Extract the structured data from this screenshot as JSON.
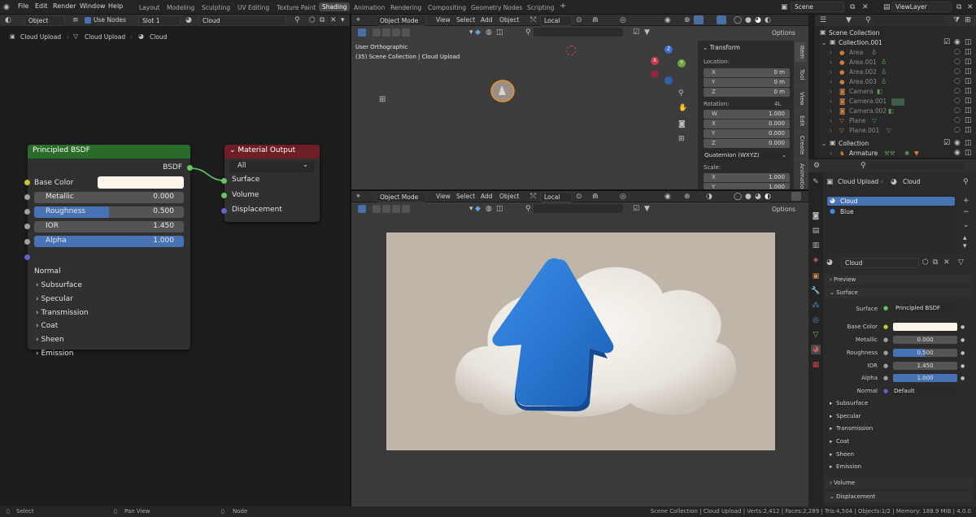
{
  "topbar": {
    "menus": [
      "File",
      "Edit",
      "Render",
      "Window",
      "Help"
    ],
    "workspaces": [
      "Layout",
      "Modeling",
      "Sculpting",
      "UV Editing",
      "Texture Paint",
      "Shading",
      "Animation",
      "Rendering",
      "Compositing",
      "Geometry Nodes",
      "Scripting"
    ],
    "active_workspace": "Shading",
    "add_tab": "+",
    "scene": "Scene",
    "view_layer": "ViewLayer"
  },
  "node_header": {
    "mode": "Object",
    "use_nodes": "Use Nodes",
    "slot": "Slot 1",
    "material": "Cloud"
  },
  "breadcrumb": [
    "Cloud Upload",
    "Cloud Upload",
    "Cloud"
  ],
  "principled": {
    "title": "Principled BSDF",
    "output": "BSDF",
    "base_color_label": "Base Color",
    "fields": [
      {
        "label": "Metallic",
        "value": "0.000"
      },
      {
        "label": "Roughness",
        "value": "0.500"
      },
      {
        "label": "IOR",
        "value": "1.450"
      },
      {
        "label": "Alpha",
        "value": "1.000"
      }
    ],
    "roughness_fill": 0.5,
    "normal": "Normal",
    "panels": [
      "Subsurface",
      "Specular",
      "Transmission",
      "Coat",
      "Sheen",
      "Emission"
    ]
  },
  "material_output": {
    "title": "Material Output",
    "target": "All",
    "sockets": [
      "Surface",
      "Volume",
      "Displacement"
    ]
  },
  "viewport_header": {
    "mode": "Object Mode",
    "menus": [
      "View",
      "Select",
      "Add",
      "Object"
    ],
    "transform": "Local",
    "options": "Options"
  },
  "viewport_top": {
    "view_name": "User Orthographic",
    "collection_info": "(35) Scene Collection | Cloud Upload"
  },
  "npanel": {
    "title": "Transform",
    "location_label": "Location:",
    "location": [
      {
        "axis": "X",
        "v": "0 m"
      },
      {
        "axis": "Y",
        "v": "0 m"
      },
      {
        "axis": "Z",
        "v": "0 m"
      }
    ],
    "rotation_label": "Rotation:",
    "rotation_mode_short": "4L",
    "rotation": [
      {
        "axis": "W",
        "v": "1.000"
      },
      {
        "axis": "X",
        "v": "0.000"
      },
      {
        "axis": "Y",
        "v": "0.000"
      },
      {
        "axis": "Z",
        "v": "0.000"
      }
    ],
    "rotation_mode": "Quaternion (WXYZ)",
    "scale_label": "Scale:",
    "scale": [
      {
        "axis": "X",
        "v": "1.000"
      },
      {
        "axis": "Y",
        "v": "1.000"
      }
    ],
    "tabs": [
      "Item",
      "Tool",
      "View",
      "Edit",
      "Create",
      "Animation"
    ]
  },
  "outliner": {
    "root": "Scene Collection",
    "collection": "Collection.001",
    "items": [
      "Area",
      "Area.001",
      "Area.002",
      "Area.003",
      "Camera",
      "Camera.001",
      "Camera.002",
      "Plane",
      "Plane.001"
    ],
    "collection2": "Collection",
    "armature": "Armature"
  },
  "properties": {
    "breadcrumb": [
      "Cloud Upload",
      "Cloud"
    ],
    "slots": [
      "Cloud",
      "Blue"
    ],
    "material": "Cloud",
    "preview": "Preview",
    "surface": "Surface",
    "surface_label": "Surface",
    "surface_value": "Principled BSDF",
    "rows": [
      {
        "label": "Base Color",
        "value": ""
      },
      {
        "label": "Metallic",
        "value": "0.000"
      },
      {
        "label": "Roughness",
        "value": "0.500"
      },
      {
        "label": "IOR",
        "value": "1.450"
      },
      {
        "label": "Alpha",
        "value": "1.000"
      },
      {
        "label": "Normal",
        "value": "Default"
      }
    ],
    "subpanels": [
      "Subsurface",
      "Specular",
      "Transmission",
      "Coat",
      "Sheen",
      "Emission"
    ],
    "volume": "Volume",
    "displacement": "Displacement"
  },
  "status": {
    "select": "Select",
    "pan": "Pan View",
    "node": "Node",
    "stats": "Scene Collection | Cloud Upload | Verts:2,412 | Faces:2,289 | Tris:4,504 | Objects:1/2 | Memory: 188.9 MiB | 4.0.0"
  },
  "colors": {
    "principled_header": "#2a6b2a",
    "output_header": "#6e1f26",
    "accent_blue": "#4772b3",
    "socket_yellow": "#c7c729",
    "socket_grey": "#a1a1a1",
    "socket_green": "#63c763",
    "socket_purple": "#6363c7",
    "cloud_bg": "#bfb5a9",
    "arrow_blue": "#1f6fd0"
  }
}
